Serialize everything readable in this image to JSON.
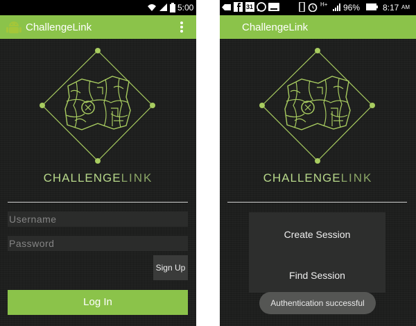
{
  "colors": {
    "accent": "#8bc34a",
    "background": "#1e1f1e",
    "logo_line": "#a8cc60",
    "status_bar": "#000000"
  },
  "login_screen": {
    "status_bar": {
      "time": "5:00"
    },
    "app_title": "ChallengeLink",
    "brand": {
      "bold": "CHALLENGE",
      "thin": "LINK"
    },
    "username_placeholder": "Username",
    "password_placeholder": "Password",
    "sign_up_label": "Sign Up",
    "log_in_label": "Log In"
  },
  "session_screen": {
    "status_bar": {
      "time": "8:17",
      "time_suffix": "AM",
      "battery": "96%",
      "calendar_day": "31",
      "network": "H+"
    },
    "app_title": "ChallengeLink",
    "brand": {
      "bold": "CHALLENGE",
      "thin": "LINK"
    },
    "create_session_label": "Create Session",
    "find_session_label": "Find Session",
    "toast_message": "Authentication successful"
  }
}
